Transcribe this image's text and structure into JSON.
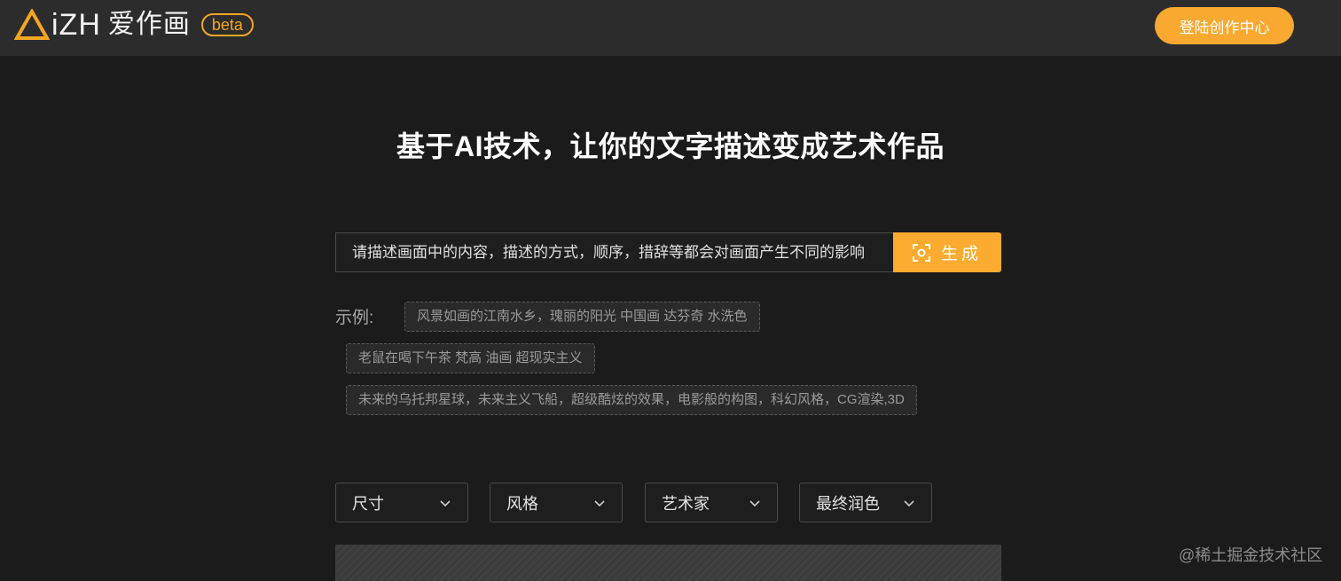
{
  "header": {
    "logo_text": "iZH",
    "logo_cn": "爱作画",
    "beta_label": "beta",
    "login_label": "登陆创作中心",
    "accent_color": "#f9a930",
    "logo_icon": "triangle-logo-icon"
  },
  "hero": {
    "title": "基于AI技术，让你的文字描述变成艺术作品"
  },
  "prompt": {
    "placeholder": "请描述画面中的内容，描述的方式，顺序，措辞等都会对画面产生不同的影响",
    "generate_label": "生成",
    "generate_icon": "scan-icon"
  },
  "examples": {
    "label": "示例:",
    "items": [
      "风景如画的江南水乡，瑰丽的阳光 中国画 达芬奇 水洗色",
      "老鼠在喝下午茶 梵高 油画 超现实主义",
      "未来的乌托邦星球，未来主义飞船，超级酷炫的效果，电影般的构图，科幻风格，CG渲染,3D"
    ]
  },
  "options": {
    "selects": [
      {
        "label": "尺寸"
      },
      {
        "label": "风格"
      },
      {
        "label": "艺术家"
      },
      {
        "label": "最终润色"
      }
    ],
    "chevron_icon": "chevron-down-icon"
  },
  "watermark": "@稀土掘金技术社区"
}
